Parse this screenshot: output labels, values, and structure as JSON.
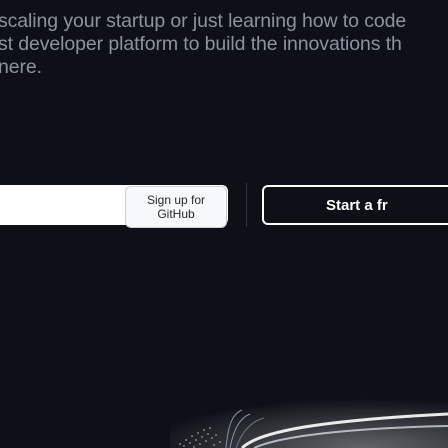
{
  "hero": {
    "line1": "scaling your startup or just learning how to code",
    "line2": "st developer platform to build the innovations th",
    "line3": "nere."
  },
  "signup": {
    "email_placeholder": "",
    "button_label": "Sign up for GitHub"
  },
  "trial": {
    "button_label": "Start a fr"
  },
  "colors": {
    "background": "#0d1117",
    "text_muted": "#8b949e",
    "white": "#ffffff"
  },
  "icons": {
    "hero_graphic": "globe-arc-graphic"
  }
}
